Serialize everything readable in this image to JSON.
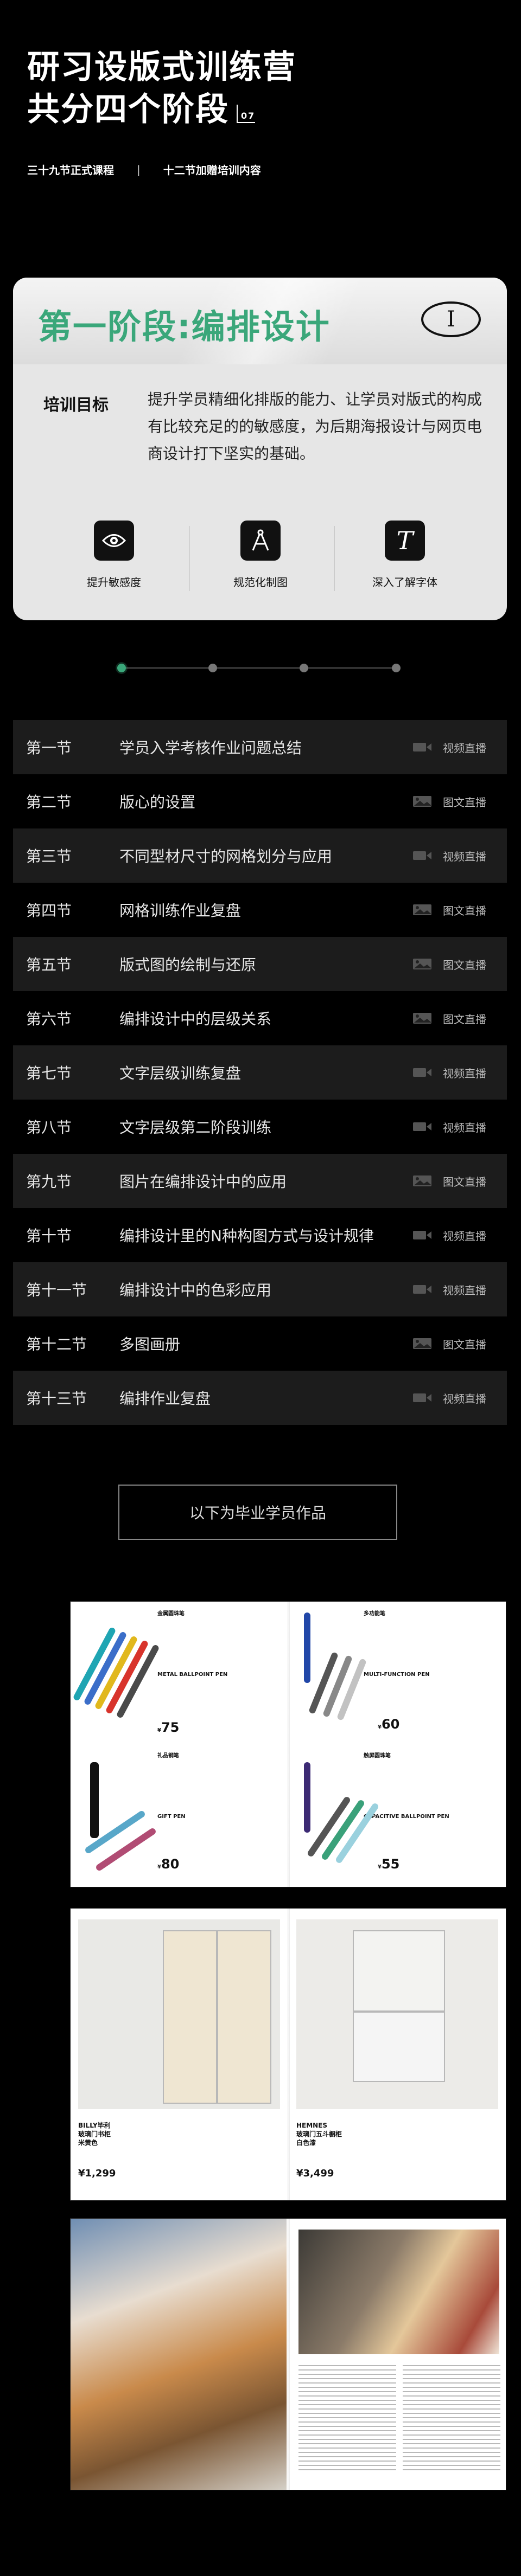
{
  "hero": {
    "title_line1": "研习设版式训练营",
    "title_line2": "共分四个阶段",
    "stage_no": "07",
    "sub_left": "三十九节正式课程",
    "sub_sep": "|",
    "sub_right": "十二节加赠培训内容"
  },
  "stage": {
    "title": "第一阶段:编排设计",
    "roman": "I",
    "goal_label": "培训目标",
    "goal_text": "提升学员精细化排版的能力、让学员对版式的构成有比较充足的的敏感度，为后期海报设计与网页电商设计打下坚实的基础。",
    "features": [
      {
        "icon": "eye-icon",
        "label": "提升敏感度"
      },
      {
        "icon": "compass-icon",
        "label": "规范化制图"
      },
      {
        "icon": "font-icon",
        "glyph": "T",
        "label": "深入了解字体"
      }
    ]
  },
  "progress": {
    "active_index": 0,
    "count": 4
  },
  "lessons": [
    {
      "no": "第一节",
      "title": "学员入学考核作业问题总结",
      "type": "视频直播",
      "kind": "video"
    },
    {
      "no": "第二节",
      "title": "版心的设置",
      "type": "图文直播",
      "kind": "image"
    },
    {
      "no": "第三节",
      "title": "不同型材尺寸的网格划分与应用",
      "type": "视频直播",
      "kind": "video"
    },
    {
      "no": "第四节",
      "title": "网格训练作业复盘",
      "type": "图文直播",
      "kind": "image"
    },
    {
      "no": "第五节",
      "title": "版式图的绘制与还原",
      "type": "图文直播",
      "kind": "image"
    },
    {
      "no": "第六节",
      "title": "编排设计中的层级关系",
      "type": "图文直播",
      "kind": "image"
    },
    {
      "no": "第七节",
      "title": "文字层级训练复盘",
      "type": "视频直播",
      "kind": "video"
    },
    {
      "no": "第八节",
      "title": "文字层级第二阶段训练",
      "type": "视频直播",
      "kind": "video"
    },
    {
      "no": "第九节",
      "title": "图片在编排设计中的应用",
      "type": "图文直播",
      "kind": "image"
    },
    {
      "no": "第十节",
      "title": "编排设计里的N种构图方式与设计规律",
      "type": "视频直播",
      "kind": "video"
    },
    {
      "no": "第十一节",
      "title": "编排设计中的色彩应用",
      "type": "视频直播",
      "kind": "video"
    },
    {
      "no": "第十二节",
      "title": "多图画册",
      "type": "图文直播",
      "kind": "image"
    },
    {
      "no": "第十三节",
      "title": "编排作业复盘",
      "type": "视频直播",
      "kind": "video"
    }
  ],
  "cta": "以下为毕业学员作品",
  "works": {
    "pens": {
      "sections": [
        "金属圆珠笔",
        "多功能笔",
        "礼品钢笔",
        "触屏圆珠笔"
      ],
      "subtitles": [
        "METAL BALLPOINT PEN",
        "MULTI-FUNCTION PEN",
        "GIFT PEN",
        "CAPACITIVE BALLPOINT PEN"
      ],
      "prices": [
        "75",
        "60",
        "80",
        "55"
      ],
      "currency": "¥"
    },
    "cabinets": {
      "left_name": "BILLY毕利\n玻璃门书柜\n米黄色",
      "left_price": "¥1,299",
      "right_name": "HEMNES\n玻璃门五斗橱柜\n白色漆",
      "right_price": "¥3,499"
    }
  }
}
